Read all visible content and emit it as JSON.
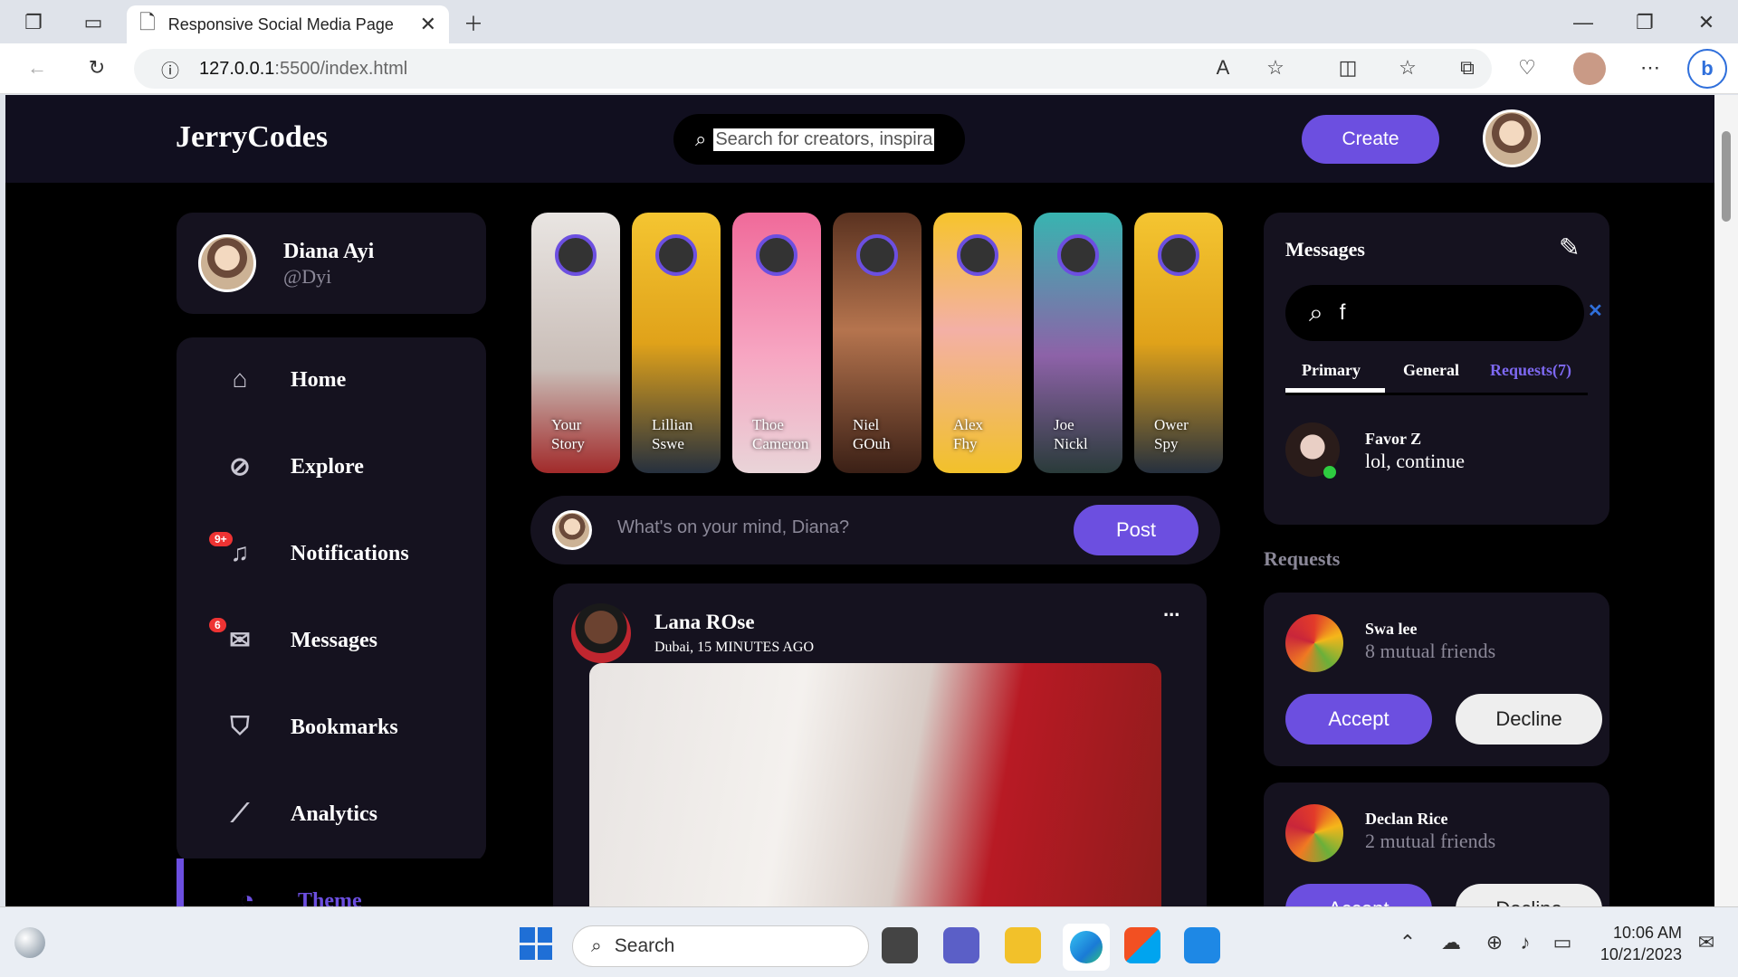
{
  "browser": {
    "tab_title": "Responsive Social Media Page",
    "url_host": "127.0.0.1",
    "url_rest": ":5500/index.html"
  },
  "nav": {
    "logo": "JerryCodes",
    "search_placeholder": "Search for creators, inspira",
    "create": "Create"
  },
  "profile": {
    "name": "Diana Ayi",
    "handle": "@Dyi"
  },
  "menu": [
    {
      "label": "Home",
      "icon": "home-icon"
    },
    {
      "label": "Explore",
      "icon": "compass-icon"
    },
    {
      "label": "Notifications",
      "icon": "bell-icon",
      "badge": "9+"
    },
    {
      "label": "Messages",
      "icon": "envelope-icon",
      "badge": "6"
    },
    {
      "label": "Bookmarks",
      "icon": "bookmark-icon"
    },
    {
      "label": "Analytics",
      "icon": "chart-icon"
    },
    {
      "label": "Theme",
      "icon": "palette-icon"
    }
  ],
  "stories": [
    {
      "line1": "Your",
      "line2": "Story",
      "color": "#d9d4d0"
    },
    {
      "line1": "Lillian",
      "line2": "Sswe",
      "color": "#e6b21c"
    },
    {
      "line1": "Thoe",
      "line2": "Cameron",
      "color": "#f0709c"
    },
    {
      "line1": "Niel",
      "line2": "GOuh",
      "color": "#8a4a2a"
    },
    {
      "line1": "Alex",
      "line2": "Fhy",
      "color": "#f2c12a"
    },
    {
      "line1": "Joe",
      "line2": "Nickl",
      "color": "#3aa6a2"
    },
    {
      "line1": "Ower",
      "line2": "Spy",
      "color": "#e6b21c"
    }
  ],
  "composer": {
    "placeholder": "What's on your mind, Diana?",
    "post": "Post"
  },
  "feed": {
    "author": "Lana ROse",
    "meta": "Dubai, 15 MINUTES AGO",
    "more": "..."
  },
  "messages": {
    "title": "Messages",
    "search_value": "f",
    "tabs": [
      "Primary",
      "General",
      "Requests(7)"
    ],
    "item": {
      "name": "Favor Z",
      "text": "lol, continue"
    }
  },
  "requests": {
    "title": "Requests",
    "items": [
      {
        "name": "Swa lee",
        "mutual": "8 mutual friends",
        "accept": "Accept",
        "decline": "Decline"
      },
      {
        "name": "Declan Rice",
        "mutual": "2 mutual friends",
        "accept": "Accept",
        "decline": "Decline"
      }
    ]
  },
  "taskbar": {
    "search": "Search",
    "time": "10:06 AM",
    "date": "10/21/2023"
  }
}
